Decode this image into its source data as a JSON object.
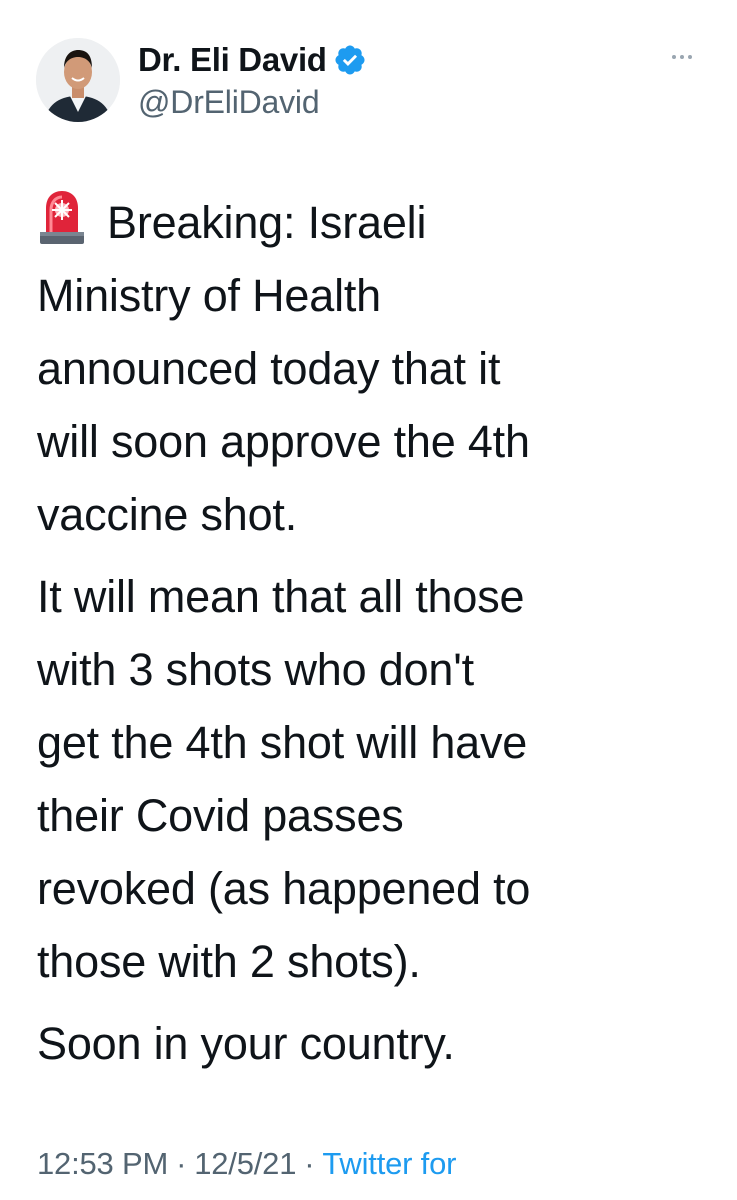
{
  "author": {
    "display_name": "Dr. Eli David",
    "handle": "@DrEliDavid",
    "verified": true
  },
  "icons": {
    "verified": "verified-badge-icon",
    "more": "more-options-icon",
    "siren": "police-car-light-emoji"
  },
  "tweet": {
    "paragraphs": [
      {
        "lines": [
          "Breaking: Israeli",
          "Ministry of Health",
          "announced today that it",
          "will soon approve the 4th",
          "vaccine shot."
        ]
      },
      {
        "lines": [
          "It will mean that all those",
          "with 3 shots who don't",
          "get the 4th shot will have",
          "their Covid passes",
          "revoked (as happened to",
          "those with 2 shots)."
        ]
      },
      {
        "lines": [
          "Soon in your country."
        ]
      }
    ]
  },
  "meta": {
    "time": "12:53 PM",
    "separator": "·",
    "date": "12/5/21",
    "source": "Twitter for"
  },
  "colors": {
    "text": "#0f1419",
    "secondary": "#536471",
    "link": "#1d9bf0",
    "verified": "#1d9bf0"
  }
}
